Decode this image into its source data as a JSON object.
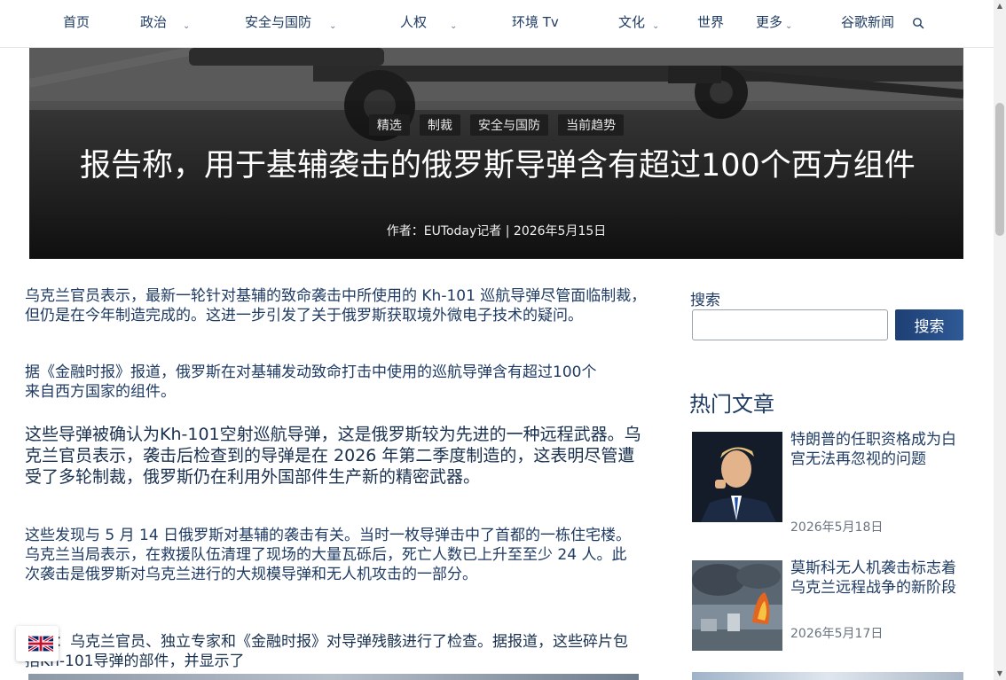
{
  "nav": {
    "items": [
      {
        "label": "首页",
        "dropdown": false
      },
      {
        "label": "政治",
        "dropdown": true
      },
      {
        "label": "安全与国防",
        "dropdown": true
      },
      {
        "label": "人权",
        "dropdown": true
      },
      {
        "label": "环境 Tv",
        "dropdown": false
      },
      {
        "label": "文化",
        "dropdown": true
      },
      {
        "label": "世界",
        "dropdown": false
      },
      {
        "label": "更多",
        "dropdown": true
      },
      {
        "label": "谷歌新闻",
        "dropdown": false
      }
    ],
    "caret": "⌄",
    "search_icon": "search-icon"
  },
  "hero": {
    "tags": [
      "精选",
      "制裁",
      "安全与国防",
      "当前趋势"
    ],
    "title": "报告称，用于基辅袭击的俄罗斯导弹含有超过100个西方组件",
    "byline": "作者：EUToday记者 | 2026年5月15日"
  },
  "article": {
    "p1": "乌克兰官员表示，最新一轮针对基辅的致命袭击中所使用的 Kh-101 巡航导弹尽管面临制裁，但仍是在今年制造完成的。这进一步引发了关于俄罗斯获取境外微电子技术的疑问。",
    "p2": "据《金融时报》报道，俄罗斯在对基辅发动致命打击中使用的巡航导弹含有超过100个来自西方国家的组件。",
    "p3": "这些导弹被确认为Kh-101空射巡航导弹，这是俄罗斯较为先进的一种远程武器。乌克兰官员表示，袭击后检查到的导弹是在 2026 年第二季度制造的，这表明尽管遭受了多轮制裁，俄罗斯仍在利用外国部件生产新的精密武器。",
    "p4": "这些发现与 5 月 14 日俄罗斯对基辅的袭击有关。当时一枚导弹击中了首都的一栋住宅楼。乌克兰当局表示，在救援队伍清理了现场的大量瓦砾后，死亡人数已上升至至少 24 人。此次袭击是俄罗斯对乌克兰进行的大规模导弹和无人机攻击的一部分。",
    "p5": "英文：乌克兰官员、独立专家和《金融时报》对导弹残骸进行了检查。据报道，这些碎片包括Kh-101导弹的部件，并显示了"
  },
  "sidebar": {
    "search_label": "搜索",
    "search_value": "",
    "search_button": "搜索",
    "hot_title": "热门文章",
    "cards": [
      {
        "title": "特朗普的任职资格成为白宫无法再忽视的问题",
        "date": "2026年5月18日"
      },
      {
        "title": "莫斯科无人机袭击标志着乌克兰远程战争的新阶段",
        "date": "2026年5月17日"
      }
    ]
  },
  "colors": {
    "link": "#1f3b63",
    "button": "#1d3f74",
    "hero_bg": "#262626"
  }
}
